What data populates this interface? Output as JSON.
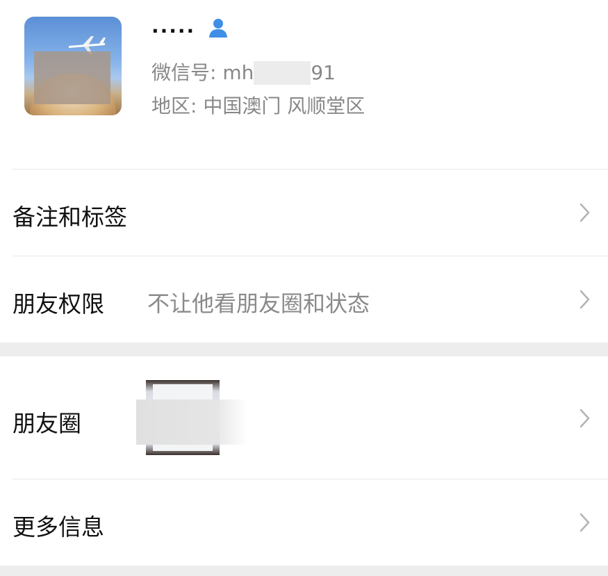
{
  "profile": {
    "nickname": "·····",
    "wechat_id_prefix": "微信号: mh",
    "wechat_id_suffix": "91",
    "region": "地区: 中国澳门 风顺堂区",
    "contact_icon": "person-icon",
    "accent_color": "#3f8fe6"
  },
  "menu": {
    "remarks_tags": {
      "label": "备注和标签"
    },
    "friend_permissions": {
      "label": "朋友权限",
      "value": "不让他看朋友圈和状态"
    },
    "moments": {
      "label": "朋友圈"
    },
    "more_info": {
      "label": "更多信息"
    }
  }
}
